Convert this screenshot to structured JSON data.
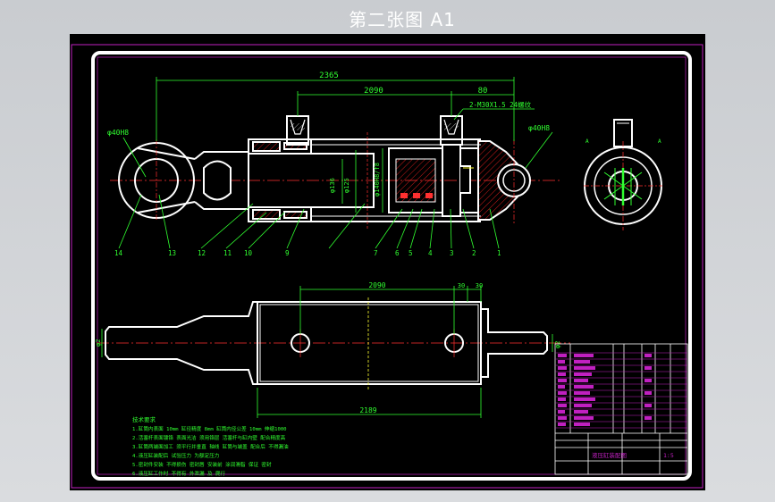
{
  "sheet": {
    "title": "第二张图 A1"
  },
  "top_view": {
    "dim_overall": "2365",
    "dim_stroke": "2090",
    "dim_offset": "80",
    "port_callout": "2-M30X1.5 24螺纹",
    "bore_left": "φ40H8",
    "bore_right": "φ40H8",
    "dia_a": "φ136",
    "dia_b": "φ125",
    "dia_c": "φ140H8/f8",
    "left_callouts": [
      "14",
      "13",
      "12",
      "11",
      "10",
      "9"
    ],
    "right_callouts": [
      "7",
      "6",
      "5",
      "4",
      "3",
      "2",
      "1"
    ],
    "end_view_labels": [
      "A",
      "A"
    ]
  },
  "bottom_view": {
    "dim_ports": "2090",
    "dim_port_a": "30",
    "dim_port_b": "30",
    "dim_bottom": "2189",
    "dim_left": "φ2",
    "dim_right": "φ2"
  },
  "notes": {
    "heading": "技术要求",
    "lines": [
      "1.缸筒内表面 10mm  缸径精度  8mm  缸筒内径公差  10mm  伸缩1000",
      "2.活塞杆表面镀铬  表面光洁  须用铬层  活塞杆与缸内壁  配合精度高",
      "3.缸筒两端面加工  须平行并垂直  轴线  缸筒与端盖  配合后  不得漏油",
      "4.液压缸装配后  试验压力  为额定压力",
      "5.密封件安装  不得损伤  密封唇  安装前  涂润滑脂  保证  密封",
      "6.液压缸工作时  不得有  外泄漏  及  爬行"
    ]
  },
  "title_block": {
    "part_name": "液压缸装配图",
    "scale": "1:5"
  }
}
